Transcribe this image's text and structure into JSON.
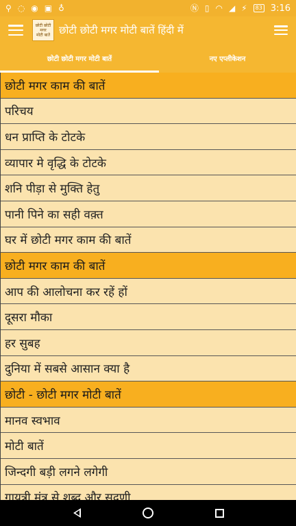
{
  "status_bar": {
    "time": "3:16",
    "battery": "83",
    "left_icons": [
      "usb-icon",
      "location-icon",
      "sync-icon",
      "image-icon",
      "bulb-icon"
    ],
    "right_icons": [
      "nfc-icon",
      "vibrate-icon",
      "wifi-icon",
      "signal-icon",
      "battery-icon"
    ]
  },
  "toolbar": {
    "title": "छोटी छोटी मगर मोटी बातें हिंदी में",
    "logo_lines": [
      "छोटी छोटी",
      "मगर",
      "मोटी बातें"
    ]
  },
  "tabs": [
    {
      "label": "छोटी छोटी मगर मोटी बातें",
      "active": true
    },
    {
      "label": "नए एप्लीकेशन",
      "active": false
    }
  ],
  "list": [
    {
      "label": "छोटी मगर काम की बातें",
      "header": true
    },
    {
      "label": "परिचय",
      "header": false
    },
    {
      "label": "धन प्राप्ति के टोटके",
      "header": false
    },
    {
      "label": "व्यापार मे वृद्धि के टोटके",
      "header": false
    },
    {
      "label": "शनि पीड़ा से मुक्ति हेतु",
      "header": false
    },
    {
      "label": "पानी पिने का सही वक़्त",
      "header": false
    },
    {
      "label": "घर में छोटी मगर काम की बातें",
      "header": false
    },
    {
      "label": "छोटी मगर काम की बातें",
      "header": true
    },
    {
      "label": "आप की आलोचना कर रहें हों",
      "header": false
    },
    {
      "label": "दूसरा मौका",
      "header": false
    },
    {
      "label": "हर सुबह",
      "header": false
    },
    {
      "label": "दुनिया में सबसे आसान क्या है",
      "header": false
    },
    {
      "label": "छोटी - छोटी मगर मोटी बातें",
      "header": true
    },
    {
      "label": "मानव स्वभाव",
      "header": false
    },
    {
      "label": "मोटी बातें",
      "header": false
    },
    {
      "label": "जिन्दगी बड़ी लगने लगेगी",
      "header": false
    },
    {
      "label": "गायत्री मंत्र से शब्द और सद्गुणी",
      "header": false
    }
  ],
  "colors": {
    "status_bar": "#f2b22e",
    "toolbar": "#f5b731",
    "row": "#fbe3ae",
    "header_row": "#f8af1f",
    "nav_bar": "#000000"
  }
}
